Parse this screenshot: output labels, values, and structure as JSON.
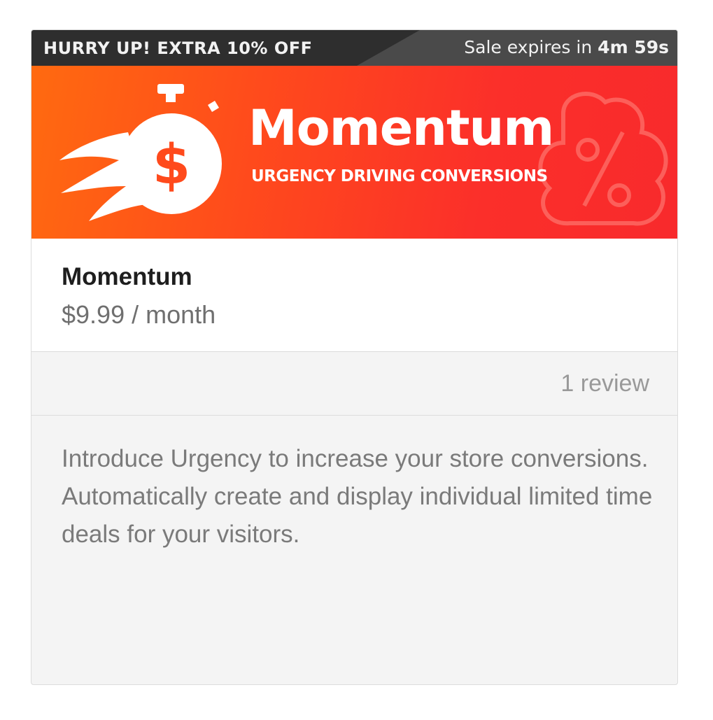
{
  "promo": {
    "headline": "HURRY UP! EXTRA 10% OFF",
    "expires_label": "Sale expires in",
    "countdown": "4m 59s"
  },
  "banner": {
    "brand_name": "Momentum",
    "tagline": "URGENCY DRIVING CONVERSIONS",
    "logo_icon": "flaming-money-stopwatch-icon",
    "decor_icon": "percent-tag-icon",
    "colors": {
      "gradient_start": "#ff6a10",
      "gradient_end": "#f82a2c",
      "promo_bar": "#2e2e2e"
    }
  },
  "app": {
    "title": "Momentum",
    "price": "$9.99 / month"
  },
  "reviews": {
    "count_label": "1 review"
  },
  "description": "Introduce Urgency to increase your store conversions. Automatically create and display individual limited time deals for your visitors."
}
